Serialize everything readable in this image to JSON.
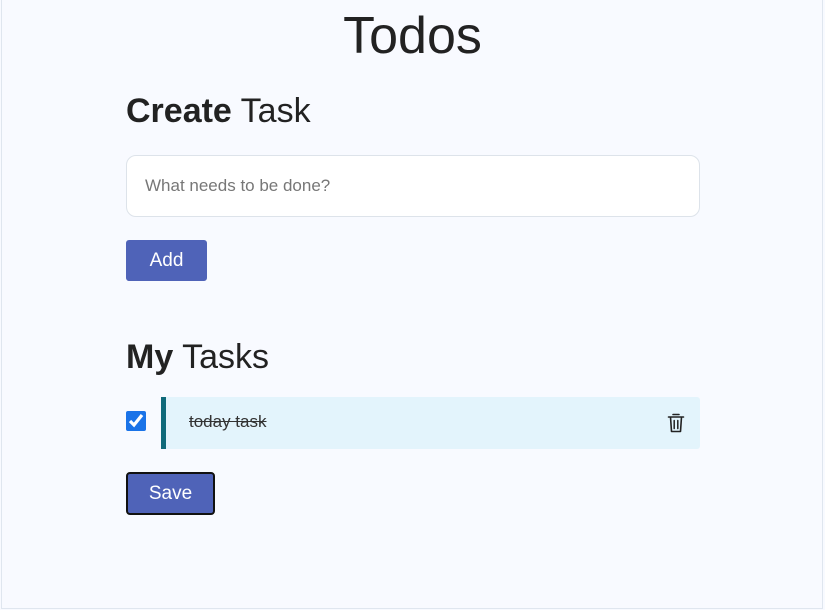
{
  "app": {
    "title": "Todos"
  },
  "create": {
    "heading_bold": "Create",
    "heading_rest": " Task",
    "input_placeholder": "What needs to be done?",
    "input_value": "",
    "add_label": "Add"
  },
  "tasks": {
    "heading_bold": "My",
    "heading_rest": " Tasks",
    "items": [
      {
        "text": "today task",
        "completed": true,
        "delete_icon": "trash-icon"
      }
    ],
    "save_label": "Save"
  },
  "colors": {
    "primary_button": "#4f63b8",
    "task_card_bg": "#e3f4fc",
    "task_card_accent": "#0f6a7a",
    "checkbox": "#1a73e8"
  }
}
